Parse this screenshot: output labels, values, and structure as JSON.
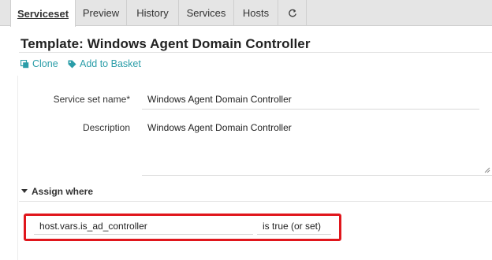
{
  "tabs": [
    {
      "label": "Serviceset",
      "active": true
    },
    {
      "label": "Preview",
      "active": false
    },
    {
      "label": "History",
      "active": false
    },
    {
      "label": "Services",
      "active": false
    },
    {
      "label": "Hosts",
      "active": false
    }
  ],
  "refresh_icon": "refresh-icon",
  "title": "Template: Windows Agent Domain Controller",
  "actions": {
    "clone": "Clone",
    "add_to_basket": "Add to Basket"
  },
  "form": {
    "service_set_name_label": "Service set name*",
    "service_set_name_value": "Windows Agent Domain Controller",
    "description_label": "Description",
    "description_value": "Windows Agent Domain Controller"
  },
  "assign_where": {
    "heading": "Assign where",
    "property": "host.vars.is_ad_controller",
    "operator": "is true (or set)"
  },
  "colors": {
    "accent": "#2a9da8",
    "highlight_border": "#e0161c",
    "tabbar_bg": "#e5e5e5"
  }
}
